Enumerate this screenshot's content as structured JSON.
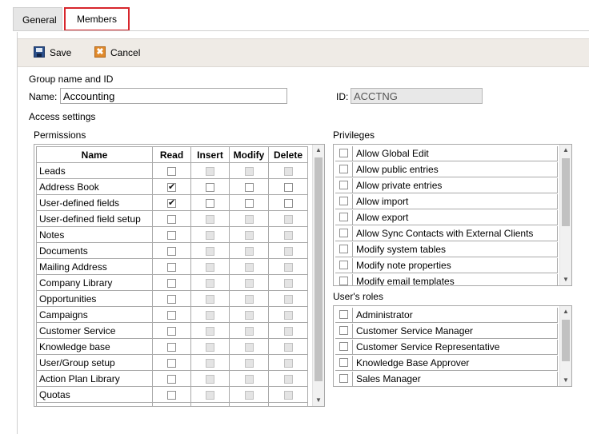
{
  "tabs": [
    {
      "label": "General"
    },
    {
      "label": "Members"
    }
  ],
  "toolbar": {
    "save_label": "Save",
    "cancel_label": "Cancel",
    "cancel_icon_glyph": "✖"
  },
  "group": {
    "section_title": "Group name and ID",
    "name_label": "Name:",
    "name_value": "Accounting",
    "id_label": "ID:",
    "id_value": "ACCTNG"
  },
  "access": {
    "section_title": "Access settings",
    "permissions_label": "Permissions",
    "privileges_label": "Privileges",
    "roles_label": "User's roles"
  },
  "permissions": {
    "columns": [
      "Name",
      "Read",
      "Insert",
      "Modify",
      "Delete"
    ],
    "rows": [
      {
        "name": "Leads",
        "read": false,
        "insert": false,
        "modify": false,
        "delete": false,
        "editable": false
      },
      {
        "name": "Address Book",
        "read": true,
        "insert": false,
        "modify": false,
        "delete": false,
        "editable": true
      },
      {
        "name": "User-defined fields",
        "read": true,
        "insert": false,
        "modify": false,
        "delete": false,
        "editable": true
      },
      {
        "name": "User-defined field setup",
        "read": false,
        "insert": false,
        "modify": false,
        "delete": false,
        "editable": false
      },
      {
        "name": "Notes",
        "read": false,
        "insert": false,
        "modify": false,
        "delete": false,
        "editable": false
      },
      {
        "name": "Documents",
        "read": false,
        "insert": false,
        "modify": false,
        "delete": false,
        "editable": false
      },
      {
        "name": "Mailing Address",
        "read": false,
        "insert": false,
        "modify": false,
        "delete": false,
        "editable": false
      },
      {
        "name": "Company Library",
        "read": false,
        "insert": false,
        "modify": false,
        "delete": false,
        "editable": false
      },
      {
        "name": "Opportunities",
        "read": false,
        "insert": false,
        "modify": false,
        "delete": false,
        "editable": false
      },
      {
        "name": "Campaigns",
        "read": false,
        "insert": false,
        "modify": false,
        "delete": false,
        "editable": false
      },
      {
        "name": "Customer Service",
        "read": false,
        "insert": false,
        "modify": false,
        "delete": false,
        "editable": false
      },
      {
        "name": "Knowledge base",
        "read": false,
        "insert": false,
        "modify": false,
        "delete": false,
        "editable": false
      },
      {
        "name": "User/Group setup",
        "read": false,
        "insert": false,
        "modify": false,
        "delete": false,
        "editable": false
      },
      {
        "name": "Action Plan Library",
        "read": false,
        "insert": false,
        "modify": false,
        "delete": false,
        "editable": false
      },
      {
        "name": "Quotas",
        "read": false,
        "insert": false,
        "modify": false,
        "delete": false,
        "editable": false
      },
      {
        "name": "",
        "read": false,
        "insert": false,
        "modify": false,
        "delete": false,
        "editable": false
      }
    ]
  },
  "privileges": [
    "Allow Global Edit",
    "Allow public entries",
    "Allow private entries",
    "Allow import",
    "Allow export",
    "Allow Sync Contacts with External Clients",
    "Modify system tables",
    "Modify note properties",
    "Modify email templates"
  ],
  "roles": [
    "Administrator",
    "Customer Service Manager",
    "Customer Service Representative",
    "Knowledge Base Approver",
    "Sales Manager"
  ],
  "scroll_icons": {
    "up": "▲",
    "down": "▼"
  }
}
